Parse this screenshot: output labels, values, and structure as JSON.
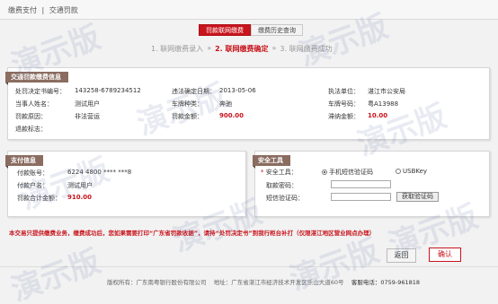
{
  "breadcrumb": {
    "part1": "缴费支付",
    "sep": "|",
    "part2": "交通罚款"
  },
  "tabs": [
    {
      "label": "罚款联网缴费"
    },
    {
      "label": "缴费历史查询"
    }
  ],
  "steps": {
    "s1": "1. 联网缴费录入",
    "s2": "2. 联网缴费确定",
    "s3": "3. 联网缴费成功",
    "arrow": "»"
  },
  "info": {
    "title": "交通罚款缴费信息",
    "doc_no_label": "处罚决定书编号：",
    "doc_no": "143258-6789234512",
    "date_label": "违法确定日期：",
    "date": "2013-05-06",
    "unit_label": "执法单位：",
    "unit": "湛江市公安局",
    "party_label": "当事人姓名：",
    "party": "测试用户",
    "vehicle_label": "车牌种类：",
    "vehicle": "奔驰",
    "plate_label": "车牌号码：",
    "plate": "粤A13988",
    "reason_label": "罚款原因：",
    "reason": "非法营运",
    "fine_label": "罚款金额：",
    "fine": "900.00",
    "late_label": "滞纳金额：",
    "late": "10.00",
    "refund_label": "退款标志：",
    "refund": ""
  },
  "payment": {
    "title": "支付信息",
    "acct_label": "付款账号：",
    "acct": "6224 4800 **** ***8",
    "name_label": "付款户名：",
    "name": "测试用户",
    "total_label": "罚款合计金额：",
    "total": "910.00"
  },
  "security": {
    "title": "安全工具",
    "tool_label": "安全工具：",
    "option_sms": "手机短信验证码",
    "option_usb": "USBKey",
    "pwd_label": "取款密码：",
    "pwd_value": "",
    "code_label": "短信验证码：",
    "code_value": "",
    "get_code_btn": "获取验证码"
  },
  "notice": "本交易只提供缴费业务，缴费成功后，您如果需要打印“广东省罚款收据”，请持“处罚决定书”到我行柜台补打（仅限湛江地区营业网点办理）",
  "actions": {
    "back": "返回",
    "confirm": "确认"
  },
  "footer": {
    "copyright": "版权所有：广东南粤银行股份有限公司",
    "address": "地址：广东省湛江市经济技术开发区乐山大道60号",
    "hotline_label": "客服电话：",
    "hotline": "0759-961818"
  },
  "watermark": "演示版",
  "colors": {
    "accent": "#c8141c",
    "panel_title": "#8a6c60"
  }
}
